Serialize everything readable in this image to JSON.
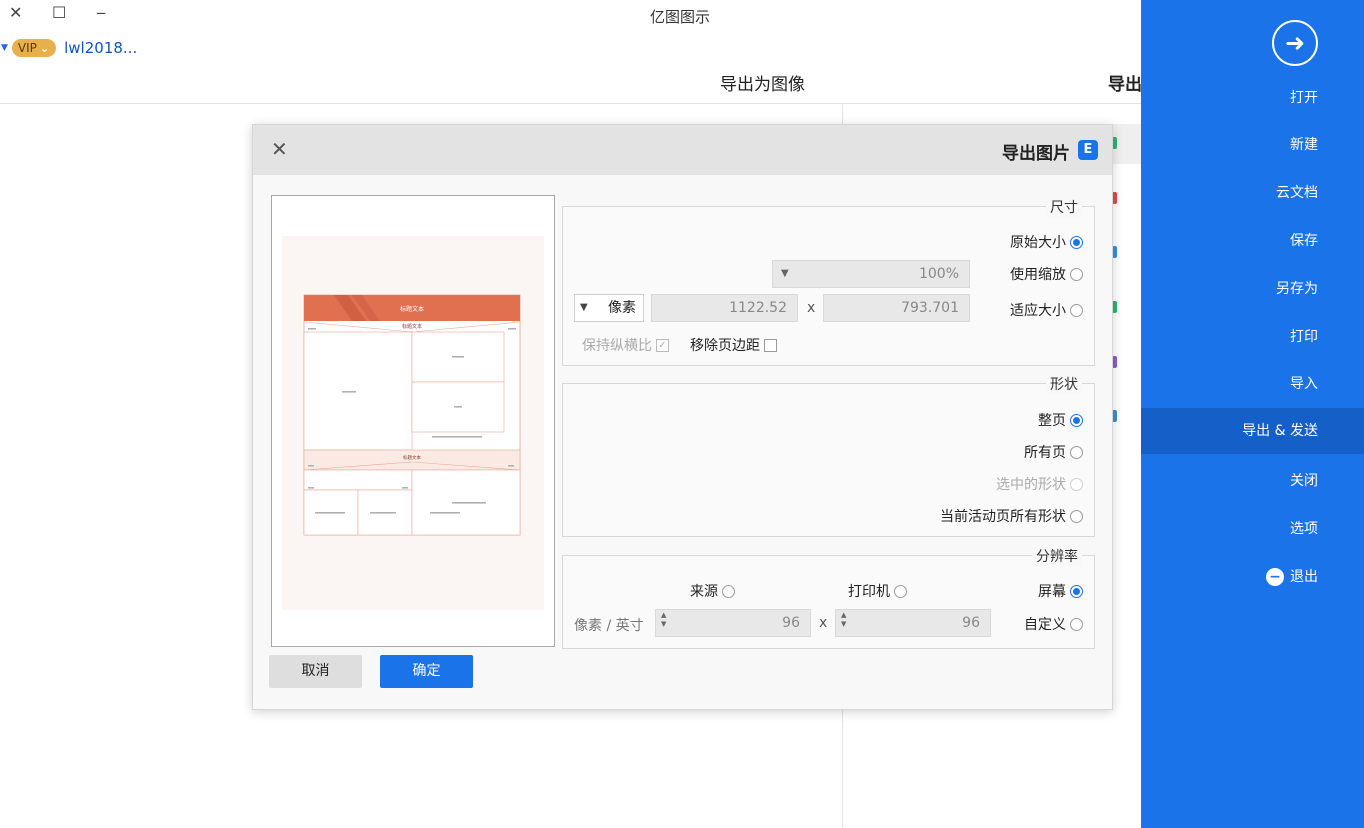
{
  "window": {
    "title": "亿图图示",
    "controls": {
      "close": "✕",
      "maximize": "☐",
      "minimize": "‒"
    }
  },
  "user": {
    "name": "lwl2018...",
    "badge": "VIP"
  },
  "page": {
    "heading": "导出",
    "active_tab": "导出为图像"
  },
  "sidebar": {
    "items": [
      {
        "label": "打开"
      },
      {
        "label": "新建"
      },
      {
        "label": "云文档"
      },
      {
        "label": "保存"
      },
      {
        "label": "另存为"
      },
      {
        "label": "打印"
      },
      {
        "label": "导入"
      },
      {
        "label": "导出 & 发送"
      },
      {
        "label": "关闭"
      },
      {
        "label": "选项"
      }
    ],
    "exit_label": "退出",
    "active_index": 7
  },
  "dialog": {
    "title": "导出图片",
    "logo": "E",
    "size_group": {
      "title": "尺寸",
      "original_size": "原始大小",
      "use_zoom": "使用缩放",
      "zoom_value": "100%",
      "fit_size": "适应大小",
      "width_value": "793.701",
      "height_value": "1122.52",
      "unit": "像素",
      "remove_margin": "移除页边距",
      "keep_ratio": "保持纵横比"
    },
    "shape_group": {
      "title": "形状",
      "whole_page": "整页",
      "all_pages": "所有页",
      "selected_shapes": "选中的形状",
      "current_page_shapes": "当前活动页所有形状"
    },
    "resolution_group": {
      "title": "分辨率",
      "screen": "屏幕",
      "printer": "打印机",
      "source": "来源",
      "custom": "自定义",
      "dpi_x": "96",
      "dpi_y": "96",
      "unit": "像素 / 英寸"
    },
    "ok_label": "确定",
    "cancel_label": "取消",
    "preview": {
      "header_text": "标题文本",
      "sub_title": "标题文本",
      "section_title": "标题文本"
    }
  },
  "colors": {
    "accent": "#1a73e8",
    "preview_header": "#e07050"
  }
}
